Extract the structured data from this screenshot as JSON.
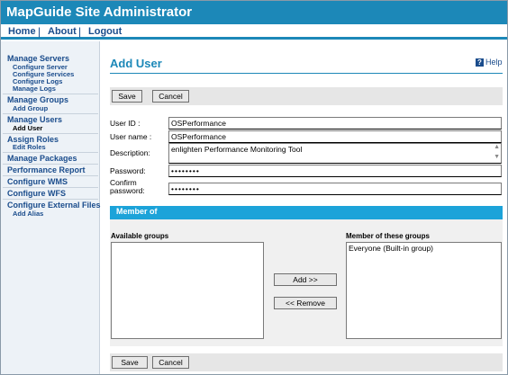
{
  "app": {
    "title": "MapGuide Site Administrator"
  },
  "nav": {
    "home": "Home",
    "sep": "|",
    "about": "About",
    "logout": "Logout"
  },
  "sidebar": {
    "manage_servers": "Manage Servers",
    "configure_server": "Configure Server",
    "configure_services": "Configure Services",
    "configure_logs": "Configure Logs",
    "manage_logs": "Manage Logs",
    "manage_groups": "Manage Groups",
    "add_group": "Add Group",
    "manage_users": "Manage Users",
    "add_user": "Add User",
    "assign_roles": "Assign Roles",
    "edit_roles": "Edit Roles",
    "manage_packages": "Manage Packages",
    "performance_report": "Performance Report",
    "configure_wms": "Configure WMS",
    "configure_wfs": "Configure WFS",
    "configure_external_files": "Configure External Files",
    "add_alias": "Add Alias"
  },
  "page": {
    "title": "Add User",
    "help": "Help"
  },
  "buttons": {
    "save": "Save",
    "cancel": "Cancel",
    "add": "Add >>",
    "remove": "<< Remove"
  },
  "form": {
    "user_id_label": "User ID :",
    "user_id_value": "OSPerformance",
    "user_name_label": "User name :",
    "user_name_value": "OSPerformance",
    "description_label": "Description:",
    "description_value": "enlighten Performance Monitoring Tool",
    "password_label": "Password:",
    "password_value": "••••••••",
    "confirm_label_1": "Confirm",
    "confirm_label_2": "password:",
    "confirm_value": "••••••••"
  },
  "member_of": {
    "header": "Member of",
    "available_label": "Available groups",
    "member_label": "Member of these groups",
    "member_groups": [
      "Everyone (Built-in group)"
    ]
  },
  "colors": {
    "brand": "#1c88b8",
    "section_header": "#1ca3d9",
    "link": "#1a4c8c"
  }
}
